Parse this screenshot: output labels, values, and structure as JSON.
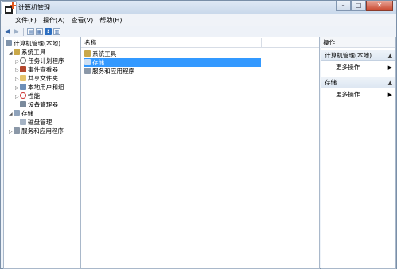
{
  "window": {
    "title": "计算机管理"
  },
  "menu": [
    "文件(F)",
    "操作(A)",
    "查看(V)",
    "帮助(H)"
  ],
  "toolbar_icons": [
    "back-arrow-icon",
    "forward-arrow-icon",
    "show-hide-tree-icon",
    "properties-icon",
    "help-icon",
    "show-hide-action-pane-icon"
  ],
  "tree": {
    "root": "计算机管理(本地)",
    "items": [
      {
        "label": "系统工具"
      },
      {
        "label": "任务计划程序"
      },
      {
        "label": "事件查看器"
      },
      {
        "label": "共享文件夹"
      },
      {
        "label": "本地用户和组"
      },
      {
        "label": "性能"
      },
      {
        "label": "设备管理器"
      },
      {
        "label": "存储"
      },
      {
        "label": "磁盘管理"
      },
      {
        "label": "服务和应用程序"
      }
    ]
  },
  "center": {
    "column_header": "名称",
    "rows": [
      {
        "label": "系统工具"
      },
      {
        "label": "存储"
      },
      {
        "label": "服务和应用程序"
      }
    ]
  },
  "actions": {
    "header": "操作",
    "groups": [
      {
        "title": "计算机管理(本地)",
        "link": "更多操作"
      },
      {
        "title": "存储",
        "link": "更多操作"
      }
    ]
  },
  "colors": {
    "selection": "#3399ff",
    "title_bar": "#c8d8ea"
  }
}
